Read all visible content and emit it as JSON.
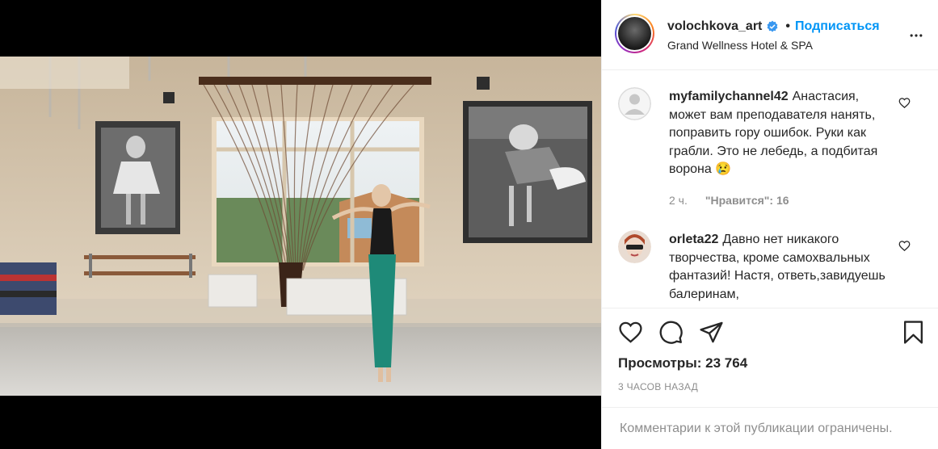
{
  "post": {
    "username": "volochkova_art",
    "dot": "•",
    "follow_label": "Подписаться",
    "location": "Grand Wellness Hotel & SPA"
  },
  "comments": [
    {
      "username": "myfamilychannel42",
      "text": "Анастасия, может вам преподавателя нанять, поправить гору ошибок. Руки как грабли. Это не лебедь, а подбитая ворона 😢",
      "time": "2 ч.",
      "likes": "\"Нравится\": 16"
    },
    {
      "username": "orleta22",
      "text": "Давно нет никакого творчества, кроме самохвальных фантазий! Настя, ответь,завидуешь балеринам,"
    }
  ],
  "footer": {
    "views_label": "Просмотры:",
    "views_count": "23 764",
    "time_ago": "3 ЧАСОВ НАЗАД",
    "comments_restricted": "Комментарии к этой публикации ограничены."
  },
  "icons": {
    "verified": "verified-badge-icon",
    "more": "more-options-icon",
    "like": "heart-icon",
    "comment": "comment-icon",
    "share": "share-icon",
    "save": "bookmark-icon",
    "mute": "muted-speaker-icon"
  },
  "colors": {
    "link_blue": "#0095f6",
    "text_primary": "#262626",
    "text_secondary": "#8e8e8e"
  }
}
